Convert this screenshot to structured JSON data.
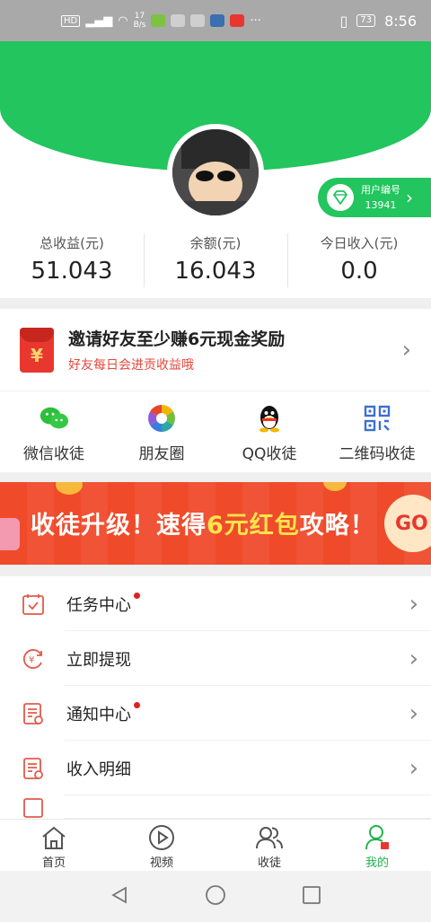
{
  "status_bar": {
    "net_speed": "17\nB/s",
    "battery": "73",
    "time": "8:56"
  },
  "profile": {
    "user_id_label": "用户编号",
    "user_id": "13941"
  },
  "stats": [
    {
      "label": "总收益(元)",
      "value": "51.043"
    },
    {
      "label": "余额(元)",
      "value": "16.043"
    },
    {
      "label": "今日收入(元)",
      "value": "0.0"
    }
  ],
  "invite": {
    "title": "邀请好友至少赚6元现金奖励",
    "subtitle": "好友每日会进贡收益哦"
  },
  "share": [
    {
      "label": "微信收徒",
      "icon": "wechat-icon"
    },
    {
      "label": "朋友圈",
      "icon": "moments-icon"
    },
    {
      "label": "QQ收徒",
      "icon": "qq-icon"
    },
    {
      "label": "二维码收徒",
      "icon": "qrcode-icon"
    }
  ],
  "banner": {
    "text_a": "收徒升级！速得",
    "text_hl": "6元红包",
    "text_b": "攻略！",
    "go": "GO"
  },
  "menu": [
    {
      "label": "任务中心",
      "dot": true
    },
    {
      "label": "立即提现",
      "dot": false
    },
    {
      "label": "通知中心",
      "dot": true
    },
    {
      "label": "收入明细",
      "dot": false
    }
  ],
  "bottom_nav": [
    {
      "label": "首页"
    },
    {
      "label": "视频"
    },
    {
      "label": "收徒"
    },
    {
      "label": "我的"
    }
  ],
  "colors": {
    "brand_green": "#22c55e",
    "accent_red": "#e8372f"
  }
}
